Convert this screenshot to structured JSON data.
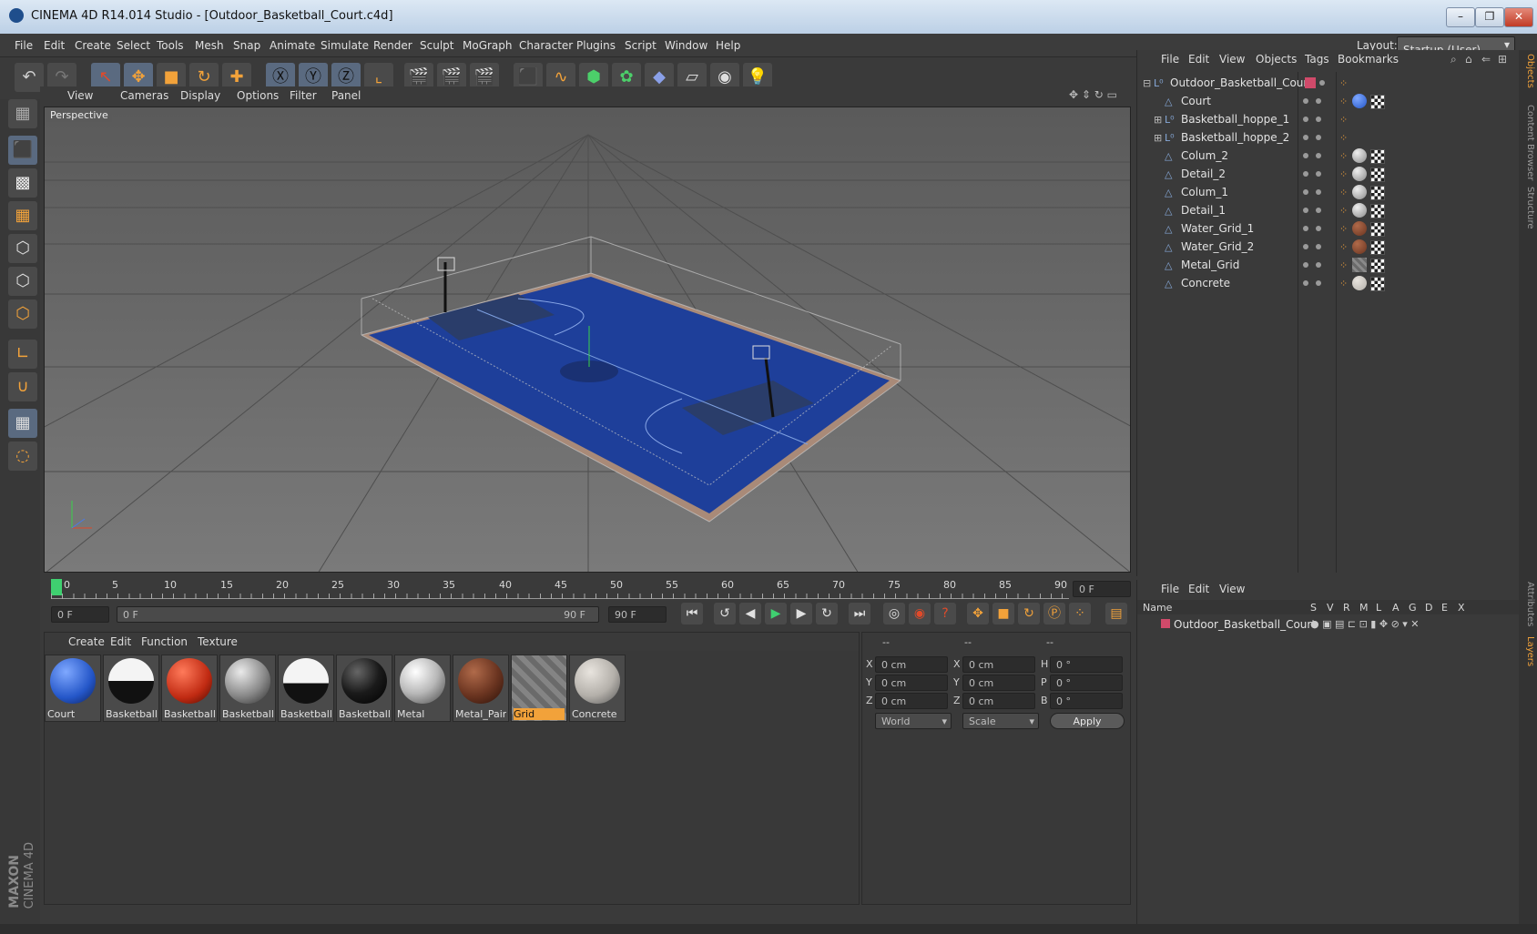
{
  "window": {
    "title": "CINEMA 4D R14.014 Studio - [Outdoor_Basketball_Court.c4d]"
  },
  "menu": [
    "File",
    "Edit",
    "Create",
    "Select",
    "Tools",
    "Mesh",
    "Snap",
    "Animate",
    "Simulate",
    "Render",
    "Sculpt",
    "MoGraph",
    "Character",
    "Plugins",
    "Script",
    "Window",
    "Help"
  ],
  "layout": {
    "label": "Layout:",
    "value": "Startup (User)"
  },
  "viewport": {
    "menu": [
      "View",
      "Cameras",
      "Display",
      "Options",
      "Filter",
      "Panel"
    ],
    "label": "Perspective"
  },
  "timeline": {
    "ticks": [
      "0",
      "5",
      "10",
      "15",
      "20",
      "25",
      "30",
      "35",
      "40",
      "45",
      "50",
      "55",
      "60",
      "65",
      "70",
      "75",
      "80",
      "85",
      "90"
    ],
    "current_frame": "0 F"
  },
  "transport": {
    "start": "0 F",
    "range_start": "0 F",
    "range_end": "90 F",
    "end": "90 F"
  },
  "materials": {
    "menu": [
      "Create",
      "Edit",
      "Function",
      "Texture"
    ],
    "items": [
      {
        "name": "Court",
        "color": "#2456c8"
      },
      {
        "name": "Basketball_",
        "color": "#e8e8e8"
      },
      {
        "name": "Basketball_",
        "color": "#c02a12"
      },
      {
        "name": "Basketball_",
        "color": "#8a8a8a"
      },
      {
        "name": "Basketball_",
        "color": "#f0f0f0"
      },
      {
        "name": "Basketball_",
        "color": "#1a1a1a"
      },
      {
        "name": "Metal",
        "color": "#b8b8b8"
      },
      {
        "name": "Metal_Pain",
        "color": "#6a3420"
      },
      {
        "name": "Grid",
        "color": "#7a7a7a"
      },
      {
        "name": "Concrete",
        "color": "#b4b0aa"
      }
    ]
  },
  "coords": {
    "headers": [
      "--",
      "--",
      "--"
    ],
    "rows": [
      {
        "a": "X",
        "v1": "0 cm",
        "b": "X",
        "v2": "0 cm",
        "c": "H",
        "v3": "0 °"
      },
      {
        "a": "Y",
        "v1": "0 cm",
        "b": "Y",
        "v2": "0 cm",
        "c": "P",
        "v3": "0 °"
      },
      {
        "a": "Z",
        "v1": "0 cm",
        "b": "Z",
        "v2": "0 cm",
        "c": "B",
        "v3": "0 °"
      }
    ],
    "mode": "World",
    "scale": "Scale",
    "apply": "Apply"
  },
  "objects": {
    "menu": [
      "File",
      "Edit",
      "View",
      "Objects",
      "Tags",
      "Bookmarks"
    ],
    "items": [
      {
        "name": "Outdoor_Basketball_Court",
        "indent": 0
      },
      {
        "name": "Court",
        "indent": 1
      },
      {
        "name": "Basketball_hoppe_1",
        "indent": 1
      },
      {
        "name": "Basketball_hoppe_2",
        "indent": 1
      },
      {
        "name": "Colum_2",
        "indent": 1
      },
      {
        "name": "Detail_2",
        "indent": 1
      },
      {
        "name": "Colum_1",
        "indent": 1
      },
      {
        "name": "Detail_1",
        "indent": 1
      },
      {
        "name": "Water_Grid_1",
        "indent": 1
      },
      {
        "name": "Water_Grid_2",
        "indent": 1
      },
      {
        "name": "Metal_Grid",
        "indent": 1
      },
      {
        "name": "Concrete",
        "indent": 1
      }
    ]
  },
  "layers": {
    "menu": [
      "File",
      "Edit",
      "View"
    ],
    "columns": [
      "Name",
      "S",
      "V",
      "R",
      "M",
      "L",
      "A",
      "G",
      "D",
      "E",
      "X"
    ],
    "row": "Outdoor_Basketball_Court"
  },
  "side_tabs": [
    "Objects",
    "Content Browser",
    "Structure",
    "Attributes",
    "Layers"
  ],
  "logo": {
    "line1": "MAXON",
    "line2": "CINEMA 4D"
  }
}
